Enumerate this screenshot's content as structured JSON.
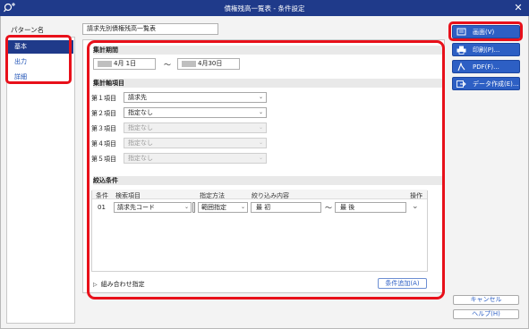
{
  "window": {
    "title": "債権残高一覧表 - 条件設定"
  },
  "sidebar": {
    "heading": "パターン名",
    "items": [
      {
        "label": "基本",
        "selected": true
      },
      {
        "label": "出力",
        "selected": false
      },
      {
        "label": "詳細",
        "selected": false
      }
    ]
  },
  "pattern_name": {
    "value": "請求先別債権残高一覧表"
  },
  "period": {
    "heading": "集計期間",
    "start": "4月  1日",
    "separator": "～",
    "end": "4月30日"
  },
  "axis": {
    "heading": "集計軸項目",
    "rows": [
      {
        "label": "第１項目",
        "value": "請求先",
        "enabled": true
      },
      {
        "label": "第２項目",
        "value": "指定なし",
        "enabled": true
      },
      {
        "label": "第３項目",
        "value": "指定なし",
        "enabled": false
      },
      {
        "label": "第４項目",
        "value": "指定なし",
        "enabled": false
      },
      {
        "label": "第５項目",
        "value": "指定なし",
        "enabled": false
      }
    ]
  },
  "filter": {
    "heading": "絞込条件",
    "columns": [
      "条件",
      "検索項目",
      "指定方法",
      "絞り込み内容",
      "操作"
    ],
    "row": {
      "no": "01",
      "item": "請求先コード",
      "method": "範囲指定",
      "from": "最 初",
      "tilde": "～",
      "to": "最 後"
    },
    "combo_toggle": "組み合わせ指定",
    "add_label": "条件追加(A)"
  },
  "buttons": {
    "screen": "画面(V)",
    "print": "印刷(P)...",
    "pdf": "PDF(F)...",
    "data": "データ作成(E)...",
    "cancel": "キャンセル",
    "help": "ヘルプ(H)"
  },
  "colors": {
    "title_bar": "#1f3a8a",
    "accent": "#2d5fc4",
    "highlight_ring": "#e8101a"
  }
}
